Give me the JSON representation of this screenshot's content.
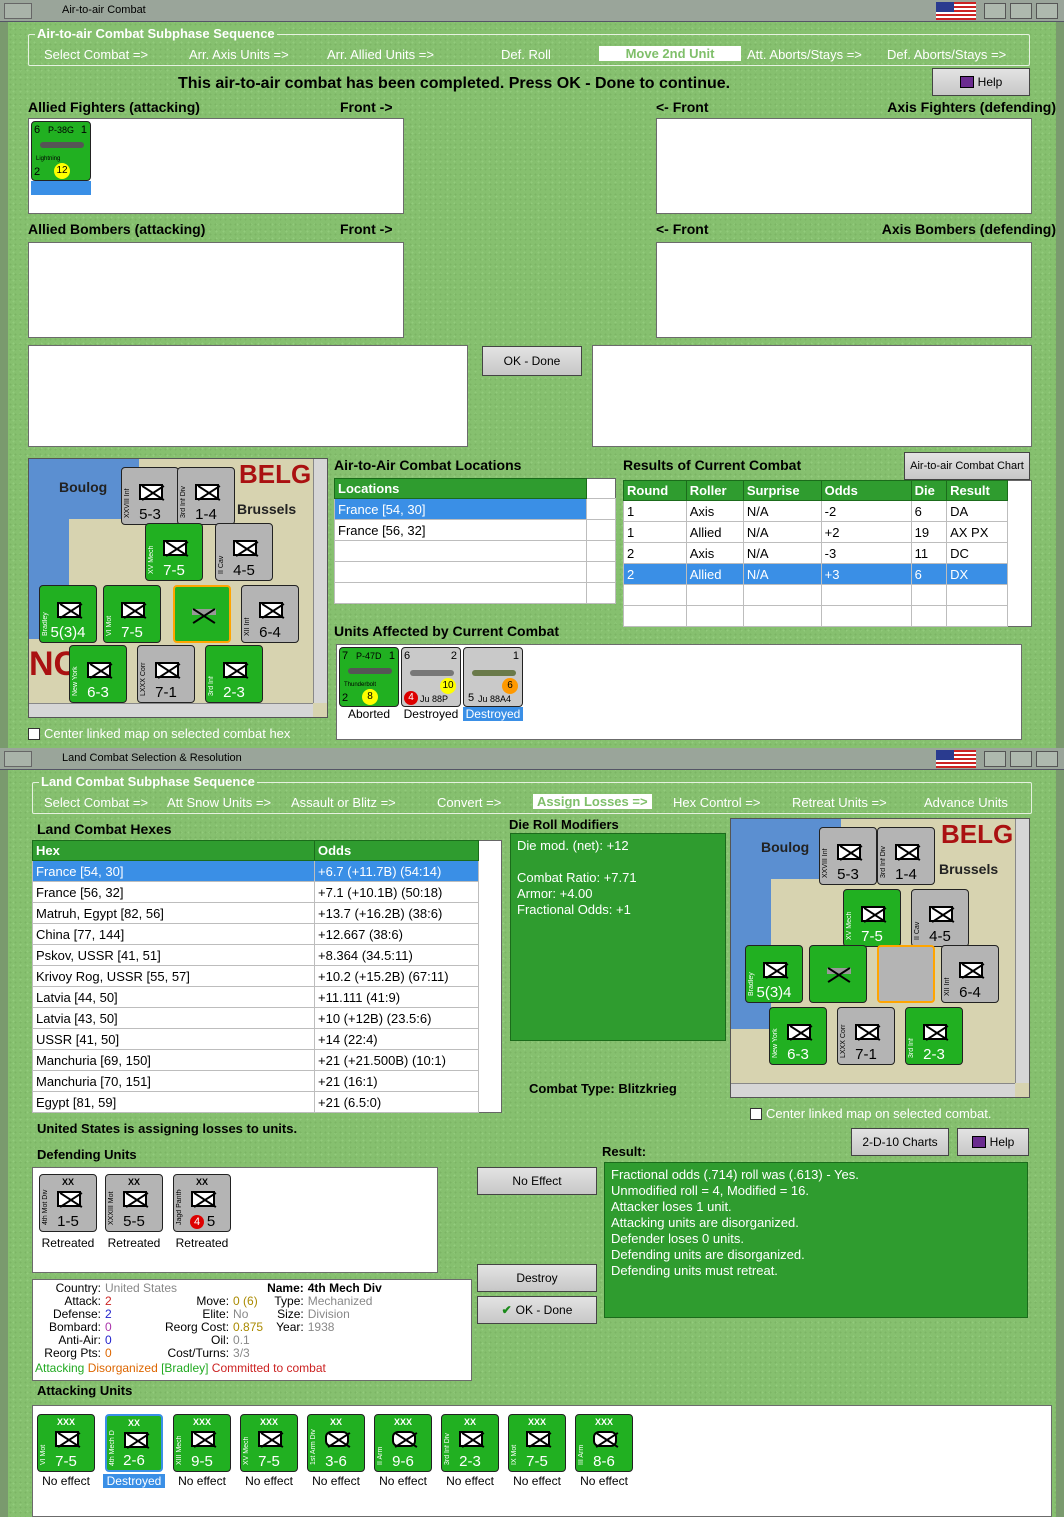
{
  "air": {
    "window_title": "Air-to-air Combat",
    "seq_title": "Air-to-air Combat Subphase Sequence",
    "seq_items": [
      "Select Combat =>",
      "Arr. Axis Units =>",
      "Arr. Allied Units =>",
      "Def. Roll",
      "Move 2nd Unit",
      "Att. Aborts/Stays =>",
      "Def. Aborts/Stays =>"
    ],
    "message": "This air-to-air combat has been completed.  Press OK - Done to continue.",
    "help": "Help",
    "allied_fighters": "Allied Fighters (attacking)",
    "axis_fighters": "Axis Fighters (defending)",
    "allied_bombers": "Allied Bombers (attacking)",
    "axis_bombers": "Axis Bombers (defending)",
    "front_right": "Front ->",
    "front_left": "<- Front",
    "ok": "OK - Done",
    "fighter_unit": {
      "name": "P-38G",
      "atk": "6",
      "def": "2",
      "range": "12",
      "model": "Lightning",
      "top": "1"
    },
    "locations_title": "Air-to-Air Combat Locations",
    "locations_header": "Locations",
    "locations": [
      "France [54, 30]",
      "France [56, 32]"
    ],
    "results_title": "Results of Current Combat",
    "chart_btn": "Air-to-air Combat Chart",
    "results_headers": [
      "Round",
      "Roller",
      "Surprise",
      "Odds",
      "Die",
      "Result"
    ],
    "results": [
      [
        "1",
        "Axis",
        "N/A",
        "-2",
        "6",
        "DA"
      ],
      [
        "1",
        "Allied",
        "N/A",
        "+2",
        "19",
        "AX PX"
      ],
      [
        "2",
        "Axis",
        "N/A",
        "-3",
        "11",
        "DC"
      ],
      [
        "2",
        "Allied",
        "N/A",
        "+3",
        "6",
        "DX"
      ]
    ],
    "affected_title": "Units Affected by Current Combat",
    "affected": [
      {
        "name": "P-47D",
        "atk": "7",
        "def": "2",
        "range": "8",
        "model": "Thunderbolt",
        "top": "1",
        "status": "Aborted"
      },
      {
        "name": "Ju 88P",
        "atk": "6",
        "def": "4",
        "range": "10",
        "top": "2",
        "status": "Destroyed"
      },
      {
        "name": "Ju 88A4",
        "atk": "5",
        "def": "",
        "range": "6",
        "top": "1",
        "status": "Destroyed"
      }
    ],
    "center_map": "Center linked map on selected combat hex"
  },
  "map": {
    "towns": [
      "Boulog",
      "Brussels",
      "BELG"
    ],
    "units": [
      {
        "num": "5-3",
        "side": "XXVIII Inf",
        "c": "gr"
      },
      {
        "num": "1-4",
        "side": "3rd Inf Div",
        "c": "gr"
      },
      {
        "num": "7-5",
        "side": "XV Mech",
        "c": "g"
      },
      {
        "num": "4-5",
        "side": "II Cav",
        "c": "gr"
      },
      {
        "num": "5(3)4",
        "side": "Bradley",
        "c": "g"
      },
      {
        "num": "7-5",
        "side": "VI Mot",
        "c": "g"
      },
      {
        "num": "6-4",
        "side": "XII Inf",
        "c": "gr"
      },
      {
        "num": "6-3",
        "side": "New York",
        "c": "g"
      },
      {
        "num": "7-1",
        "side": "LXXX Corr",
        "c": "gr"
      },
      {
        "num": "2-3",
        "side": "3rd Inf",
        "c": "g"
      }
    ]
  },
  "land": {
    "window_title": "Land Combat Selection & Resolution",
    "seq_title": "Land Combat Subphase Sequence",
    "seq_items": [
      "Select Combat =>",
      "Att Snow Units =>",
      "Assault or Blitz =>",
      "Convert =>",
      "Assign Losses =>",
      "Hex Control =>",
      "Retreat Units =>",
      "Advance Units"
    ],
    "hexes_title": "Land Combat Hexes",
    "hexes_headers": [
      "Hex",
      "Odds"
    ],
    "hexes": [
      [
        "France [54, 30]",
        "+6.7 (+11.7B) (54:14)"
      ],
      [
        "France [56, 32]",
        "+7.1 (+10.1B) (50:18)"
      ],
      [
        "Matruh, Egypt [82, 56]",
        "+13.7 (+16.2B) (38:6)"
      ],
      [
        "China [77, 144]",
        "+12.667 (38:6)"
      ],
      [
        "Pskov, USSR [41, 51]",
        "+8.364 (34.5:11)"
      ],
      [
        "Krivoy Rog, USSR [55, 57]",
        "+10.2 (+15.2B) (67:11)"
      ],
      [
        "Latvia [44, 50]",
        "+11.111 (41:9)"
      ],
      [
        "Latvia [43, 50]",
        "+10 (+12B) (23.5:6)"
      ],
      [
        "USSR [41, 50]",
        "+14 (22:4)"
      ],
      [
        "Manchuria [69, 150]",
        "+21 (+21.500B) (10:1)"
      ],
      [
        "Manchuria [70, 151]",
        "+21 (16:1)"
      ],
      [
        "Egypt [81, 59]",
        "+21 (6.5:0)"
      ]
    ],
    "drm_title": "Die Roll Modifiers",
    "drm": [
      "Die mod. (net): +12",
      "",
      "Combat Ratio: +7.71",
      "Armor: +4.00",
      "Fractional Odds: +1"
    ],
    "combat_type": "Combat Type:  Blitzkrieg",
    "center_map": "Center linked map on selected combat.",
    "assigning": "United States is assigning losses to units.",
    "charts_btn": "2-D-10 Charts",
    "help": "Help",
    "defending_title": "Defending Units",
    "defenders": [
      {
        "num": "1-5",
        "side": "4th Mot Div",
        "status": "Retreated"
      },
      {
        "num": "5-5",
        "side": "XXXIII Mot",
        "status": "Retreated"
      },
      {
        "num": "5",
        "side": "Jagd Panther",
        "status": "Retreated",
        "red": "4"
      }
    ],
    "no_effect_btn": "No Effect",
    "destroy_btn": "Destroy",
    "ok_btn": "OK - Done",
    "result_title": "Result:",
    "result_lines": [
      "Fractional odds (.714) roll was (.613)  - Yes.",
      "Unmodified roll = 4, Modified = 16.",
      "Attacker loses 1 unit.",
      "Attacking units are disorganized.",
      "Defender loses 0 units.",
      "Defending units are disorganized.",
      "Defending units must retreat."
    ],
    "info": {
      "country_k": "Country:",
      "country_v": "United States",
      "name_k": "Name:",
      "name_v": "4th Mech Div",
      "attack_k": "Attack:",
      "attack_v": "2",
      "defense_k": "Defense:",
      "defense_v": "2",
      "bombard_k": "Bombard:",
      "bombard_v": "0",
      "antiair_k": "Anti-Air:",
      "antiair_v": "0",
      "reorg_k": "Reorg Pts:",
      "reorg_v": "0",
      "move_k": "Move:",
      "move_v": "0 (6)",
      "elite_k": "Elite:",
      "elite_v": "No",
      "reorgcost_k": "Reorg Cost:",
      "reorgcost_v": "0.875",
      "oil_k": "Oil:",
      "oil_v": "0.1",
      "costturns_k": "Cost/Turns:",
      "costturns_v": "3/3",
      "type_k": "Type:",
      "type_v": "Mechanized",
      "size_k": "Size:",
      "size_v": "Division",
      "year_k": "Year:",
      "year_v": "1938",
      "status_attacking": "Attacking",
      "status_disorg": "Disorganized",
      "status_bradley": "[Bradley]",
      "status_committed": "Committed to combat"
    },
    "attacking_title": "Attacking Units",
    "attackers": [
      {
        "num": "7-5",
        "side": "VI Mot",
        "size": "XXX",
        "status": "No effect"
      },
      {
        "num": "2-6",
        "side": "4th Mech Div",
        "size": "XX",
        "status": "Destroyed"
      },
      {
        "num": "9-5",
        "side": "XIII Mech",
        "size": "XXX",
        "status": "No effect"
      },
      {
        "num": "7-5",
        "side": "XV Mech",
        "size": "XXX",
        "status": "No effect"
      },
      {
        "num": "3-6",
        "side": "1st Arm Div",
        "size": "XX",
        "status": "No effect"
      },
      {
        "num": "9-6",
        "side": "II Arm",
        "size": "XXX",
        "status": "No effect"
      },
      {
        "num": "2-3",
        "side": "3rd Inf Div",
        "size": "XX",
        "status": "No effect"
      },
      {
        "num": "7-5",
        "side": "IX Mot",
        "size": "XXX",
        "status": "No effect"
      },
      {
        "num": "8-6",
        "side": "III Arm",
        "size": "XXX",
        "status": "No effect"
      }
    ]
  }
}
